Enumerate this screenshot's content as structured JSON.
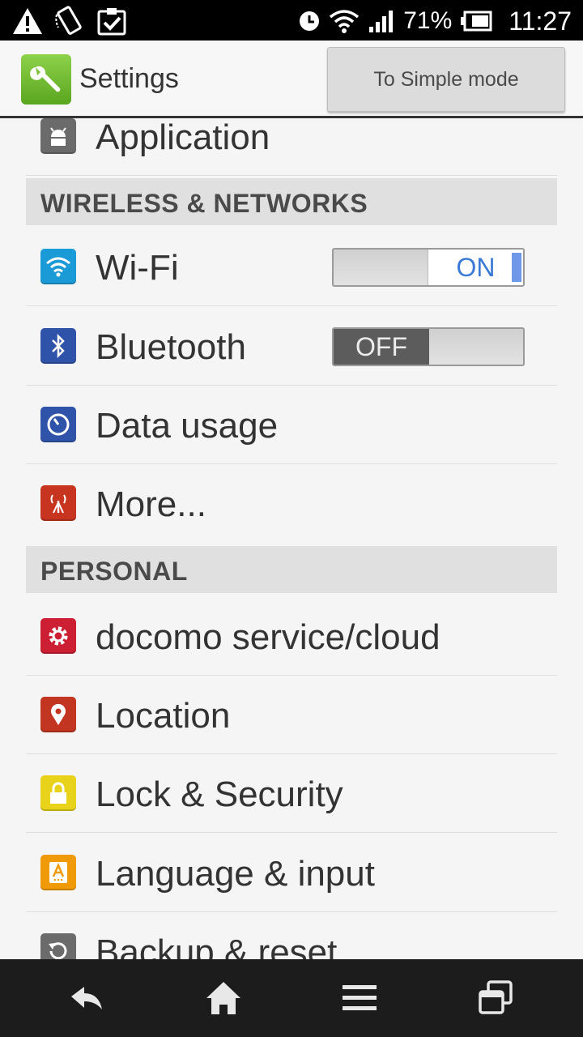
{
  "status_bar": {
    "battery_percent": "71%",
    "time": "11:27",
    "icons": [
      "warning-icon",
      "no-rotation-icon",
      "task-icon",
      "alarm-icon",
      "wifi-icon",
      "signal-icon",
      "battery-icon"
    ]
  },
  "header": {
    "title": "Settings",
    "simple_mode_button": "To Simple mode"
  },
  "list": {
    "application_label": "Application",
    "section_wireless": "WIRELESS & NETWORKS",
    "wifi_label": "Wi-Fi",
    "wifi_toggle": "ON",
    "bluetooth_label": "Bluetooth",
    "bluetooth_toggle": "OFF",
    "data_usage_label": "Data usage",
    "more_label": "More...",
    "section_personal": "PERSONAL",
    "docomo_label": "docomo service/cloud",
    "location_label": "Location",
    "lock_label": "Lock & Security",
    "language_label": "Language & input",
    "backup_label": "Backup & reset"
  },
  "colors": {
    "wifi_icon": "#1a9ad6",
    "bluetooth_icon": "#2f53a8",
    "data_usage_icon": "#2f53a8",
    "more_icon": "#c7341f",
    "docomo_icon": "#cc1f33",
    "location_icon": "#c23520",
    "lock_icon": "#e8d21a",
    "language_icon": "#f09a0a",
    "toggle_on_text": "#3a7ad6"
  }
}
